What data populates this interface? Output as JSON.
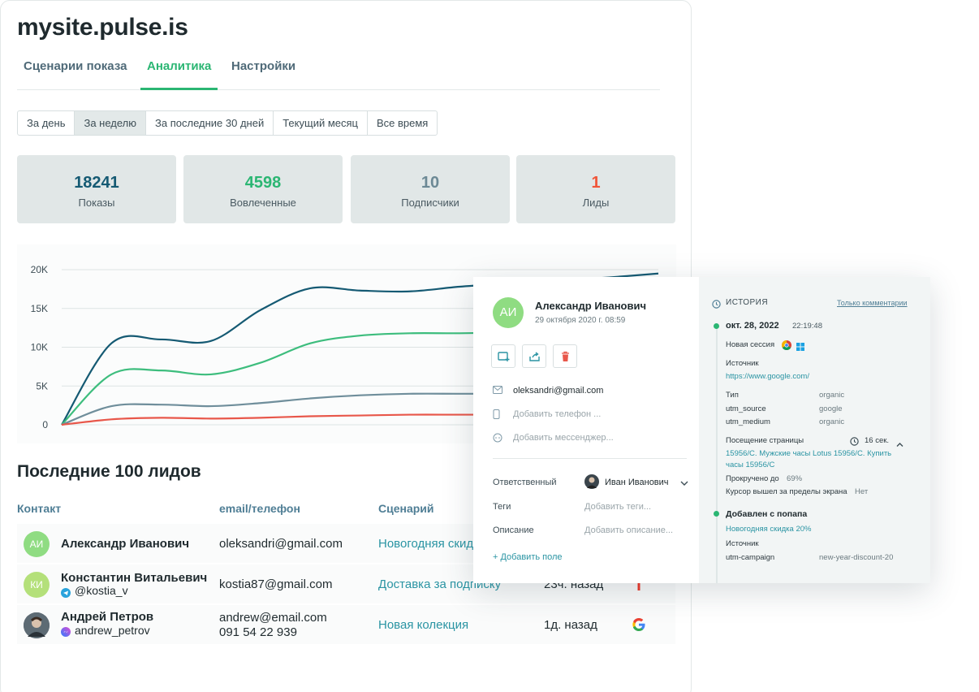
{
  "site": {
    "title": "mysite.pulse.is"
  },
  "tabs": [
    {
      "label": "Сценарии показа",
      "active": false
    },
    {
      "label": "Аналитика",
      "active": true
    },
    {
      "label": "Настройки",
      "active": false
    }
  ],
  "periods": [
    {
      "label": "За день",
      "active": false
    },
    {
      "label": "За неделю",
      "active": true
    },
    {
      "label": "За последние 30 дней",
      "active": false
    },
    {
      "label": "Текущий месяц",
      "active": false
    },
    {
      "label": "Все время",
      "active": false
    }
  ],
  "stats": [
    {
      "value": "18241",
      "label": "Показы",
      "color": "#155a73"
    },
    {
      "value": "4598",
      "label": "Вовлеченные",
      "color": "#2bb673"
    },
    {
      "value": "10",
      "label": "Подписчики",
      "color": "#6c8995"
    },
    {
      "value": "1",
      "label": "Лиды",
      "color": "#f0563a"
    }
  ],
  "chart_data": {
    "type": "line",
    "title": "",
    "xlabel": "",
    "ylabel": "",
    "y_ticks": [
      "0",
      "5K",
      "10K",
      "15K",
      "20K"
    ],
    "ylim": [
      0,
      20000
    ],
    "x": [
      0,
      1,
      2,
      3,
      4,
      5,
      6,
      7,
      8,
      9,
      10,
      11,
      12
    ],
    "grid": true,
    "series": [
      {
        "color": "#155a73",
        "values": [
          0,
          10500,
          11000,
          10800,
          14800,
          17600,
          17300,
          17200,
          17800,
          18200,
          18600,
          19000,
          19500
        ]
      },
      {
        "color": "#3dbd7d",
        "values": [
          0,
          6500,
          7000,
          6500,
          8000,
          10500,
          11500,
          11800,
          11800,
          11900,
          12000,
          12000,
          12100
        ]
      },
      {
        "color": "#6f8e9b",
        "values": [
          0,
          2400,
          2600,
          2400,
          2800,
          3400,
          3800,
          4000,
          4000,
          4000,
          4100,
          4100,
          4100
        ]
      },
      {
        "color": "#e8574a",
        "values": [
          0,
          700,
          900,
          800,
          900,
          1100,
          1200,
          1300,
          1300,
          1300,
          1300,
          1300,
          1300
        ]
      }
    ]
  },
  "leads": {
    "title": "Последние 100 лидов",
    "columns": [
      "Контакт",
      "email/телефон",
      "Сценарий"
    ],
    "rows": [
      {
        "initials": "АИ",
        "avatar_color": "#8fdc82",
        "name": "Александр Иванович",
        "sub": "",
        "email": "oleksandri@gmail.com",
        "phone": "",
        "scenario": "Новогодняя скидка 20%",
        "time": "",
        "source_icon": ""
      },
      {
        "initials": "КИ",
        "avatar_color": "#b4e07a",
        "name": "Константин Витальевич",
        "sub": "@kostia_v",
        "sub_icon": "telegram-icon",
        "email": "kostia87@gmail.com",
        "phone": "",
        "scenario": "Доставка за подписку",
        "time": "23ч. назад",
        "source_icon": "yandex-icon"
      },
      {
        "initials": "",
        "avatar_color": "#4a5660",
        "name": "Андрей Петров",
        "sub": "andrew_petrov",
        "sub_icon": "messenger-icon",
        "email": "andrew@email.com",
        "phone": "091 54 22 939",
        "scenario": "Новая колекция",
        "time": "1д. назад",
        "source_icon": "google-icon"
      }
    ]
  },
  "contact_card": {
    "initials": "АИ",
    "name": "Александр Иванович",
    "date": "29 октября 2020 г. 08:59",
    "email": "oleksandri@gmail.com",
    "phone_placeholder": "Добавить телефон ...",
    "messenger_placeholder": "Добавить мессенджер...",
    "fields": [
      {
        "label": "Ответственный",
        "value": "Иван Иванович"
      },
      {
        "label": "Теги",
        "value": "Добавить теги..."
      },
      {
        "label": "Описание",
        "value": "Добавить описание..."
      }
    ],
    "add_field": "+ Добавить поле"
  },
  "history": {
    "title": "ИСТОРИЯ",
    "filter_link": "Только комментарии",
    "event1": {
      "date": "окт. 28, 2022",
      "time": "22:19:48",
      "session_label": "Новая сессия",
      "source_label": "Источник",
      "source_url": "https://www.google.com/",
      "params": [
        {
          "key": "Тип",
          "value": "organic"
        },
        {
          "key": "utm_source",
          "value": "google"
        },
        {
          "key": "utm_medium",
          "value": "organic"
        }
      ],
      "page_visit_label": "Посещение страницы",
      "page_visit_duration": "16 сек.",
      "page_line1": "15956/C. Мужские часы Lotus 15956/C. Купить",
      "page_line2": "часы 15956/C",
      "scrolled_label": "Прокручено до",
      "scrolled_value": "69%",
      "cursor_label": "Курсор вышел за пределы экрана",
      "cursor_value": "Нет"
    },
    "event2": {
      "title": "Добавлен с попапа",
      "popup_link": "Новогодняя скидка 20%",
      "source_label": "Источник",
      "campaign_key": "utm-campaign",
      "campaign_value": "new-year-discount-20"
    }
  }
}
